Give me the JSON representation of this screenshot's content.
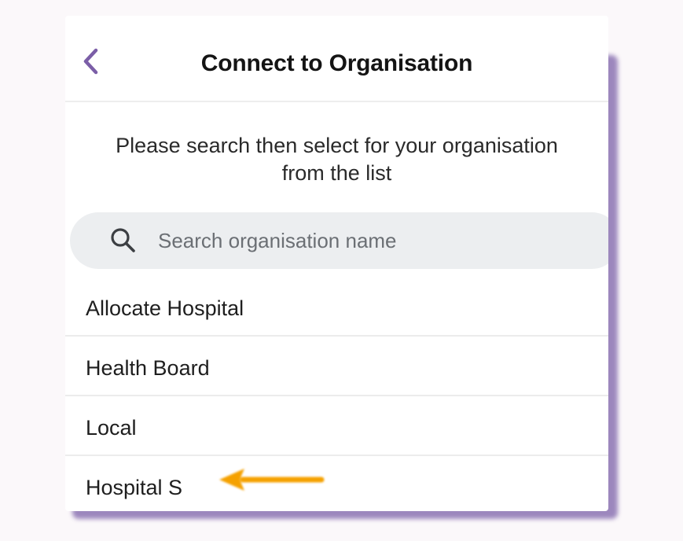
{
  "header": {
    "back_icon": "chevron-left-icon",
    "title": "Connect to Organisation"
  },
  "instructions": {
    "text": "Please search then select for your organisation from the list"
  },
  "search": {
    "icon": "search-icon",
    "placeholder": "Search organisation name",
    "value": ""
  },
  "organisations": [
    {
      "label": "Allocate Hospital"
    },
    {
      "label": "Health Board"
    },
    {
      "label": "Local"
    },
    {
      "label": "Hospital S"
    }
  ],
  "annotation": {
    "icon": "arrow-left-icon",
    "points_to": "Hospital S"
  },
  "colors": {
    "accent": "#7b5ea7",
    "frame_shadow": "#8c74b3",
    "annotation_arrow": "#f5a100",
    "search_background": "#eceef0"
  }
}
